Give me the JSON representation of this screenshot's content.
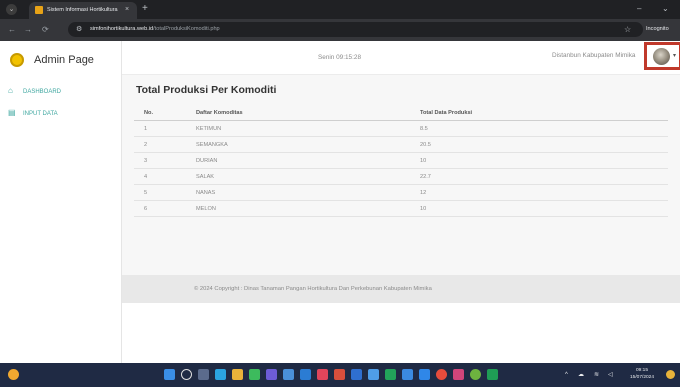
{
  "browser": {
    "tab_title": "Sistem Informasi Hortikultura",
    "tab_close": "×",
    "new_tab": "+",
    "url_host": "simfonihortikultura.web.id",
    "url_path": "/totalProduksiKomoditi.php",
    "incognito_label": "Incognito",
    "icons": {
      "tab_menu": "⌄",
      "back": "←",
      "forward": "→",
      "reload": "⟳",
      "site_info": "⚙",
      "star": "☆",
      "incognito": "🕵",
      "minimize": "–",
      "close": "⌄"
    }
  },
  "sidebar": {
    "brand": "Admin Page",
    "items": [
      {
        "label": "DASHBOARD",
        "icon": "⌂"
      },
      {
        "label": "INPUT DATA",
        "icon": "▤"
      }
    ]
  },
  "header": {
    "date": "Senin 09:15:28",
    "org": "Distanbun Kabupaten Mimika",
    "caret": "▾"
  },
  "main": {
    "title": "Total Produksi Per Komoditi",
    "columns": [
      "No.",
      "Daftar Komoditas",
      "Total Data Produksi"
    ],
    "rows": [
      [
        "1",
        "KETIMUN",
        "8.5"
      ],
      [
        "2",
        "SEMANGKA",
        "20.5"
      ],
      [
        "3",
        "DURIAN",
        "10"
      ],
      [
        "4",
        "SALAK",
        "22.7"
      ],
      [
        "5",
        "NANAS",
        "12"
      ],
      [
        "6",
        "MELON",
        "10"
      ]
    ]
  },
  "footer": {
    "text": "© 2024 Copyright : Dinas Tanaman Pangan Hortikultura Dan Perkebunan Kabupaten Mimika"
  },
  "taskbar": {
    "time": "09:15",
    "date": "15/07/2024"
  },
  "colors": {
    "accent": "#3fa7a0",
    "highlight": "#c0392b",
    "brand_logo": "#f2c200"
  }
}
